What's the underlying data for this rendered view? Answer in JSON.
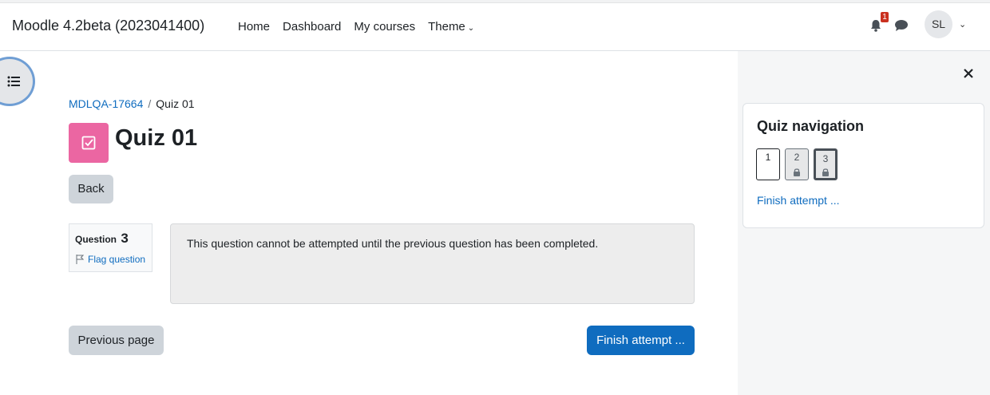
{
  "header": {
    "site_name": "Moodle 4.2beta (2023041400)",
    "nav": [
      {
        "label": "Home"
      },
      {
        "label": "Dashboard"
      },
      {
        "label": "My courses"
      },
      {
        "label": "Theme"
      }
    ],
    "notification_count": "1",
    "user_initials": "SL"
  },
  "breadcrumb": {
    "course": "MDLQA-17664",
    "current": "Quiz 01"
  },
  "page": {
    "title": "Quiz 01",
    "back_label": "Back"
  },
  "question": {
    "label": "Question",
    "number": "3",
    "flag_label": "Flag question",
    "text": "This question cannot be attempted until the previous question has been completed."
  },
  "buttons": {
    "previous_page": "Previous page",
    "finish_attempt": "Finish attempt ..."
  },
  "quiz_navigation": {
    "title": "Quiz navigation",
    "questions": [
      {
        "num": "1",
        "state": "unlocked"
      },
      {
        "num": "2",
        "state": "locked"
      },
      {
        "num": "3",
        "state": "locked-current"
      }
    ],
    "finish_link": "Finish attempt ..."
  },
  "colors": {
    "primary": "#0f6cbf",
    "quiz_icon": "#eb66a2",
    "badge": "#ca3120"
  }
}
